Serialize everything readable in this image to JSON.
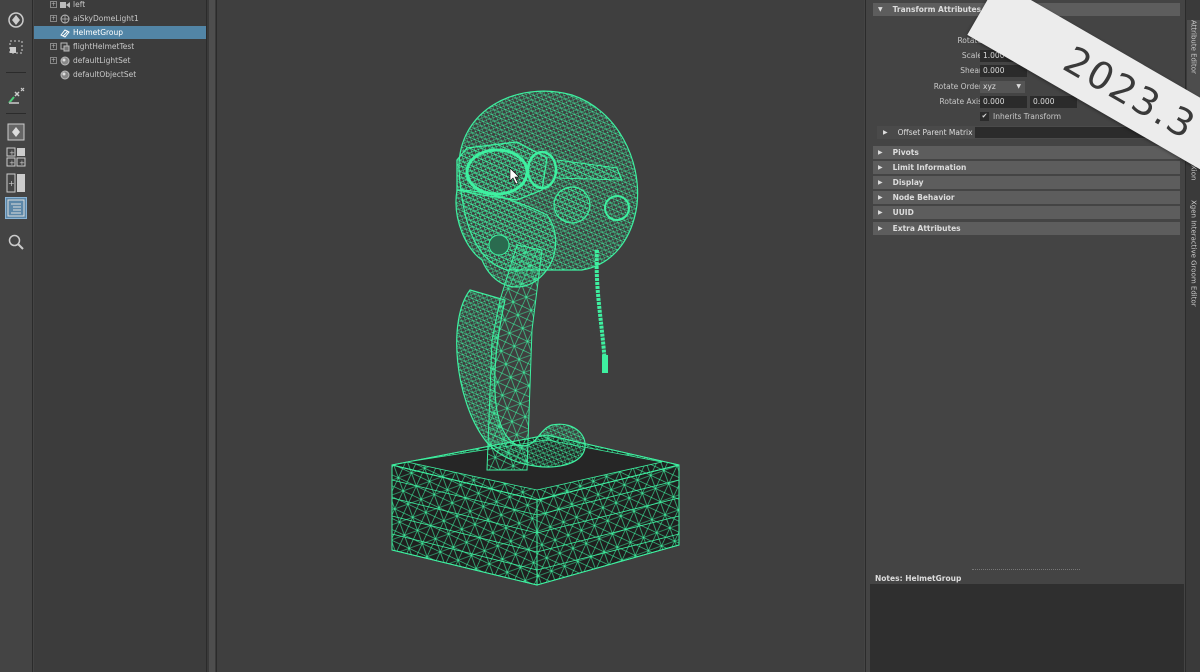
{
  "toolbox": {
    "tools": [
      "move-tool",
      "marquee-tool",
      "sculpt-tool",
      "single-view-layout",
      "four-view-layout",
      "two-view-layout",
      "outliner-layout",
      "search-tool"
    ]
  },
  "outliner": {
    "items": [
      {
        "label": "left",
        "icon": "camera-icon",
        "expandable": true,
        "selected": false
      },
      {
        "label": "aiSkyDomeLight1",
        "icon": "skydome-light-icon",
        "expandable": true,
        "selected": false
      },
      {
        "label": "HelmetGroup",
        "icon": "group-icon",
        "expandable": false,
        "selected": true
      },
      {
        "label": "flightHelmetTest",
        "icon": "transform-icon",
        "expandable": true,
        "selected": false
      },
      {
        "label": "defaultLightSet",
        "icon": "set-icon",
        "expandable": true,
        "selected": false
      },
      {
        "label": "defaultObjectSet",
        "icon": "set-icon",
        "expandable": false,
        "selected": false
      }
    ]
  },
  "attribute_editor": {
    "transform_section": "Transform Attributes",
    "rotate_label": "Rotate",
    "scale_label": "Scale",
    "scale_x": "1.000",
    "shear_label": "Shear",
    "shear_x": "0.000",
    "rotate_order_label": "Rotate Order",
    "rotate_order_value": "xyz",
    "rotate_axis_label": "Rotate Axis",
    "rotate_axis_x": "0.000",
    "rotate_axis_y": "0.000",
    "inherits_transform_label": "Inherits Transform",
    "inherits_transform_checked": true,
    "offset_parent_matrix": "Offset Parent Matrix",
    "sections": [
      "Pivots",
      "Limit Information",
      "Display",
      "Node Behavior",
      "UUID",
      "Extra Attributes"
    ],
    "notes_label": "Notes:",
    "notes_node": "HelmetGroup"
  },
  "side_tabs": [
    "Attribute Editor",
    "Xion",
    "Xgen Interactive Groom Editor"
  ],
  "version_badge": "2023.3",
  "colors": {
    "wireframe": "#3ef0a0",
    "selection": "#5285a6",
    "viewport_bg": "#3f3f3f"
  }
}
